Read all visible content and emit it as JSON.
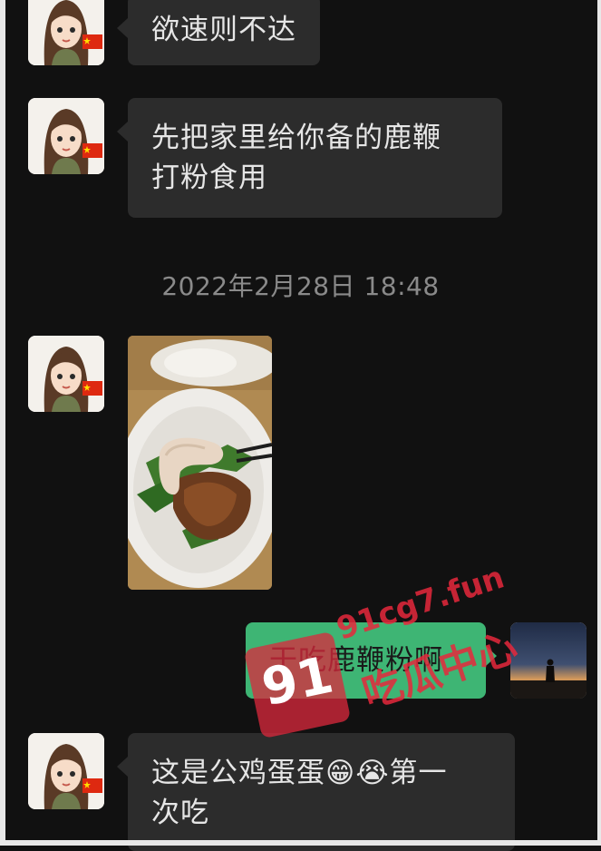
{
  "messages": [
    {
      "sender": "contact",
      "text": "欲速则不达"
    },
    {
      "sender": "contact",
      "text_line1": "先把家里给你备的鹿鞭",
      "text_line2": "打粉食用"
    },
    {
      "sender": "contact",
      "type": "image",
      "image_description": "photo-of-dish"
    },
    {
      "sender": "me",
      "text": "干吃鹿鞭粉啊"
    },
    {
      "sender": "contact",
      "text_line1": "这是公鸡蛋蛋😁😭第一",
      "text_line2": "次吃"
    }
  ],
  "timestamp": "2022年2月28日 18:48",
  "watermark": {
    "logo": "91",
    "url": "91cg7.fun",
    "name": "吃瓜中心"
  },
  "colors": {
    "background": "#111111",
    "incoming_bubble": "#2c2c2c",
    "outgoing_bubble": "#3eb574",
    "timestamp": "#8a8a8a"
  }
}
